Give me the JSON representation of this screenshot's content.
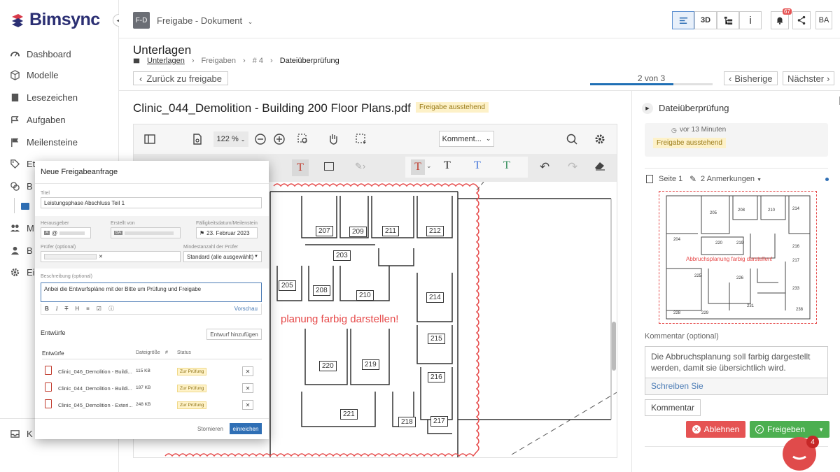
{
  "brand": {
    "name": "Bimsync"
  },
  "sidebar": {
    "items": [
      {
        "label": "Dashboard",
        "icon": "dashboard-icon"
      },
      {
        "label": "Modelle",
        "icon": "cube-icon"
      },
      {
        "label": "Lesezeichen",
        "icon": "bookmark-icon"
      },
      {
        "label": "Aufgaben",
        "icon": "tasks-icon"
      },
      {
        "label": "Meilensteine",
        "icon": "flag-icon"
      },
      {
        "label": "Et",
        "icon": "tag-icon"
      },
      {
        "label": "B",
        "icon": "layers-icon"
      },
      {
        "label": "M",
        "icon": "users-icon"
      },
      {
        "label": "B",
        "icon": "person-icon"
      },
      {
        "label": "Ei",
        "icon": "gear-icon"
      },
      {
        "label": "K",
        "icon": "inbox-icon"
      }
    ]
  },
  "topbar": {
    "doc_badge": "F-D",
    "doc_title": "Freigabe - Dokument",
    "view_3d": "3D",
    "info": "i",
    "notifications": "67",
    "user": "BA"
  },
  "header": {
    "title": "Unterlagen",
    "breadcrumb": [
      "Unterlagen",
      "Freigaben",
      "# 4",
      "Dateiüberprüfung"
    ],
    "back": "Zurück zu freigabe",
    "pager": "2 von 3",
    "prev": "Bisherige",
    "next": "Nächster"
  },
  "file": {
    "title": "Clinic_044_Demolition - Building 200 Floor Plans.pdf",
    "status": "Freigabe ausstehend"
  },
  "viewer": {
    "zoom": "122 %",
    "comment_select": "Komment...",
    "plan_note": "planung farbig darstellen!",
    "rooms": [
      "207",
      "209",
      "211",
      "212",
      "203",
      "205",
      "208",
      "210",
      "214",
      "215",
      "220",
      "219",
      "216",
      "221",
      "218",
      "217"
    ]
  },
  "right_panel": {
    "title": "Dateiüberprüfung",
    "time": "vor 13 Minuten",
    "status": "Freigabe ausstehend",
    "page": "Seite 1",
    "annotations": "2 Anmerkungen",
    "thumb_note": "Abbruchsplanung farbig darstellen!",
    "comment_label": "Kommentar (optional)",
    "comment_text": "Die Abbruchsplanung soll farbig dargestellt werden, damit sie übersichtlich wird.",
    "write": "Schreiben Sie",
    "comment_button": "Kommentar",
    "reject": "Ablehnen",
    "approve": "Freigeben",
    "chat_badge": "4"
  },
  "modal": {
    "title": "Neue Freigabeanfrage",
    "title_label": "Titel",
    "title_value": "Leistungsphase Abschluss Teil 1",
    "publisher_label": "Herausgeber",
    "publisher_value": "@",
    "created_label": "Erstellt von",
    "created_value": "BA",
    "due_label": "Fälligkeitsdatum/Meilenstein",
    "due_value": "23. Februar 2023",
    "reviewer_label": "Prüfer (optional)",
    "min_label": "Mindestanzahl der Prüfer",
    "min_value": "Standard (alle ausgewählt)",
    "desc_label": "Beschreibung (optional)",
    "desc_value": "Anbei die Entwurfspläne mit der Bitte um Prüfung und Freigabe",
    "preview": "Vorschau",
    "drafts_label": "Entwürfe",
    "add_draft": "Entwurf hinzufügen",
    "col_drafts": "Entwürfe",
    "col_size": "Dateigröße",
    "col_status": "Status",
    "rows": [
      {
        "name": "Clinic_046_Demolition - Buildi...",
        "size": "115 KB",
        "status": "Zur Prüfung"
      },
      {
        "name": "Clinic_044_Demolition - Buildi...",
        "size": "187 KB",
        "status": "Zur Prüfung"
      },
      {
        "name": "Clinic_045_Demolition - Exteri...",
        "size": "248 KB",
        "status": "Zur Prüfung"
      }
    ],
    "cancel": "Stornieren",
    "submit": "einreichen"
  },
  "colors": {
    "brand": "#2b2f73",
    "accent": "#1f6fb5",
    "reject": "#e55353",
    "approve": "#4caf50",
    "pending_bg": "#fdf1c8"
  }
}
